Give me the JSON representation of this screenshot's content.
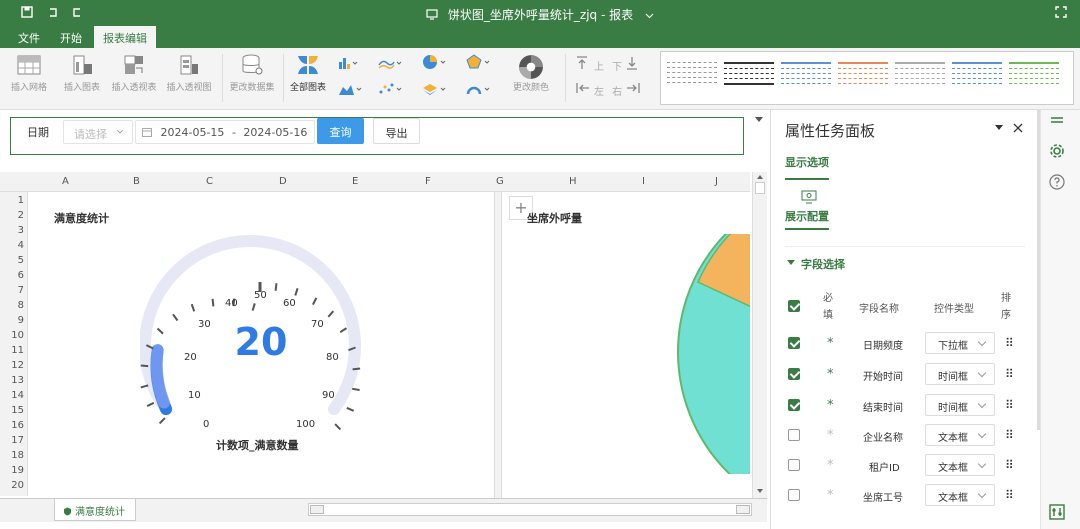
{
  "window": {
    "title": "饼状图_坐席外呼量统计_zjq - 报表"
  },
  "menu": [
    {
      "label": "文件",
      "active": false
    },
    {
      "label": "开始",
      "active": false
    },
    {
      "label": "报表编辑",
      "active": true
    }
  ],
  "ribbon": {
    "buttons": [
      {
        "label": "插入网格",
        "icon": "grid-icon"
      },
      {
        "label": "插入图表",
        "icon": "chart-icon"
      },
      {
        "label": "插入透视表",
        "icon": "pivot-table-icon"
      },
      {
        "label": "插入透视图",
        "icon": "pivot-chart-icon"
      },
      {
        "label": "更改数据集",
        "icon": "database-icon"
      },
      {
        "label": "全部图表",
        "icon": "all-charts-icon"
      },
      {
        "label": "更改颜色",
        "icon": "palette-icon"
      }
    ],
    "align_labels": {
      "top": "上",
      "down": "下",
      "left": "左",
      "right": "右"
    }
  },
  "filter": {
    "date_label": "日期",
    "select_placeholder": "请选择",
    "start_date": "2024-05-15",
    "date_sep": "-",
    "end_date": "2024-05-16",
    "query_label": "查询",
    "export_label": "导出"
  },
  "sheet": {
    "columns": [
      "A",
      "B",
      "C",
      "D",
      "E",
      "F",
      "G",
      "H",
      "I",
      "J"
    ],
    "rows": [
      "1",
      "2",
      "3",
      "4",
      "5",
      "6",
      "7",
      "8",
      "9",
      "10",
      "11",
      "12",
      "13",
      "14",
      "15",
      "16",
      "17",
      "18",
      "19",
      "20"
    ],
    "tab_label": "满意度统计"
  },
  "gauge_chart": {
    "title": "满意度统计",
    "value_text": "20",
    "subtitle": "计数项_满意数量",
    "tick_labels": [
      "0",
      "10",
      "20",
      "30",
      "40",
      "50",
      "60",
      "70",
      "80",
      "90",
      "100"
    ],
    "colors": {
      "value": "#2f7be5",
      "track": "#e6e9f5",
      "ticks": "#555"
    }
  },
  "pie_chart": {
    "title": "坐席外呼量",
    "colors": {
      "teal": "#6fe0d2",
      "orange": "#f4b45e",
      "border": "#5fb870"
    }
  },
  "panel": {
    "title": "属性任务面板",
    "tab_display": "显示选项",
    "tab_config": "展示配置",
    "section": "字段选择",
    "headers": {
      "required": "必填",
      "field": "字段名称",
      "control": "控件类型",
      "order": "排序"
    },
    "rows": [
      {
        "checked": true,
        "field": "日期频度",
        "control": "下拉框"
      },
      {
        "checked": true,
        "field": "开始时间",
        "control": "时间框"
      },
      {
        "checked": true,
        "field": "结束时间",
        "control": "时间框"
      },
      {
        "checked": false,
        "field": "企业名称",
        "control": "文本框"
      },
      {
        "checked": false,
        "field": "租户ID",
        "control": "文本框"
      },
      {
        "checked": false,
        "field": "坐席工号",
        "control": "文本框"
      }
    ],
    "required_mark": "*"
  },
  "colors": {
    "brand": "#3a7d44",
    "query_btn": "#3d9ae8"
  }
}
